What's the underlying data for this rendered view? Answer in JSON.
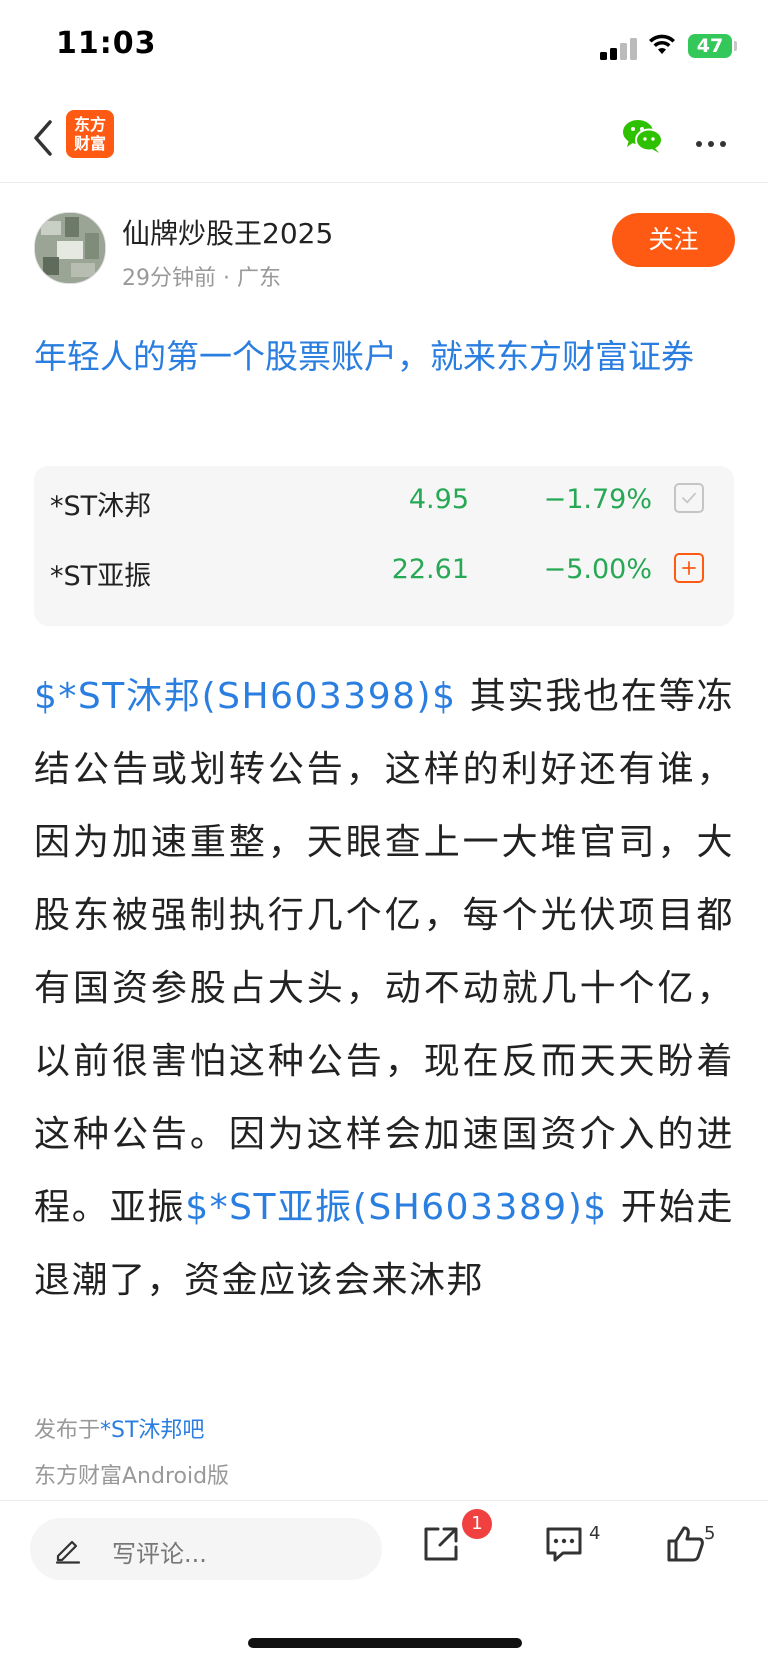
{
  "status_bar": {
    "time": "11:03",
    "battery": "47"
  },
  "nav": {
    "logo_line1": "东方",
    "logo_line2": "财富"
  },
  "author": {
    "name": "仙牌炒股王2025",
    "meta": "29分钟前 · 广东",
    "follow_label": "关注"
  },
  "ad_text": "年轻人的第一个股票账户，就来东方财富证券",
  "stocks": [
    {
      "name": "*ST沐邦",
      "price": "4.95",
      "change": "−1.79%",
      "action": "added"
    },
    {
      "name": "*ST亚振",
      "price": "22.61",
      "change": "−5.00%",
      "action": "add"
    }
  ],
  "post": {
    "link1": "$*ST沐邦(SH603398)$",
    "text1": " 其实我也在等冻结公告或划转公告，这样的利好还有谁，因为加速重整，天眼查上一大堆官司，大股东被强制执行几个亿，每个光伏项目都有国资参股占大头，动不动就几十个亿，以前很害怕这种公告，现在反而天天盼着这种公告。因为这样会加速国资介入的进程。亚振",
    "link2": "$*ST亚振(SH603389)$",
    "text2": " 开始走退潮了，资金应该会来沐邦"
  },
  "footer": {
    "posted_prefix": "发布于",
    "bar_name": "*ST沐邦吧",
    "client": "东方财富Android版"
  },
  "bottom_bar": {
    "comment_placeholder": "写评论...",
    "share_badge": "1",
    "comment_count": "4",
    "like_count": "5"
  },
  "colors": {
    "accent": "#ff5a14",
    "link": "#2a7ee0",
    "down": "#27a854",
    "badge": "#f04040"
  },
  "icons": [
    "back-icon",
    "wechat-icon",
    "more-icon",
    "check-icon",
    "plus-icon",
    "pen-icon",
    "share-icon",
    "comment-icon",
    "thumbs-up-icon"
  ]
}
